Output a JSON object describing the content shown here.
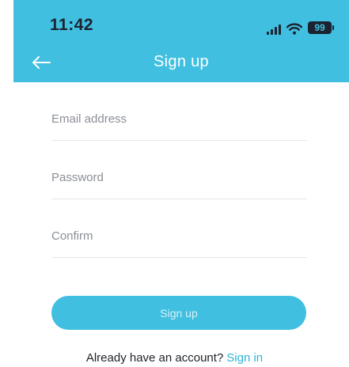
{
  "status_bar": {
    "time": "11:42",
    "battery": "99",
    "icons": [
      "signal-icon",
      "wifi-icon",
      "battery-icon"
    ]
  },
  "nav": {
    "title": "Sign up",
    "back_icon": "arrow-left-icon"
  },
  "form": {
    "email": {
      "placeholder": "Email address",
      "value": ""
    },
    "password": {
      "placeholder": "Password",
      "value": ""
    },
    "confirm": {
      "placeholder": "Confirm",
      "value": ""
    },
    "submit_label": "Sign up"
  },
  "footer": {
    "prompt": "Already have an account?",
    "link_label": "Sign in"
  },
  "colors": {
    "accent": "#40bfe0",
    "link": "#2fb3d6",
    "divider": "#e3e6ea",
    "placeholder": "#8a8f96"
  }
}
